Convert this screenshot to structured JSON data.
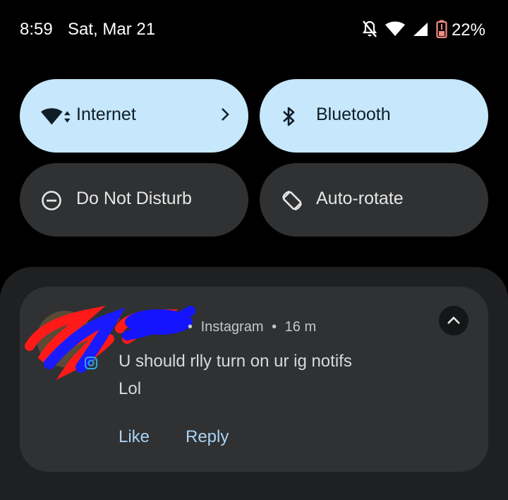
{
  "status_bar": {
    "time": "8:59",
    "date": "Sat, Mar 21",
    "battery_percent": "22%",
    "icons": [
      "bell-off-icon",
      "wifi-icon",
      "cell-signal-icon",
      "battery-low-icon"
    ]
  },
  "quick_settings": {
    "tiles": [
      {
        "label": "Internet",
        "state": "on",
        "icon": "wifi-icon",
        "has_chevron": true
      },
      {
        "label": "Bluetooth",
        "state": "on",
        "icon": "bluetooth-icon"
      },
      {
        "label": "Do Not Disturb",
        "state": "off",
        "icon": "dnd-icon"
      },
      {
        "label": "Auto-rotate",
        "state": "off",
        "icon": "rotate-icon"
      }
    ]
  },
  "notification": {
    "app": "Instagram",
    "separator": "•",
    "time_ago": "16 m",
    "message_line1": "U should rlly turn on ur ig notifs",
    "message_line2": "Lol",
    "actions": [
      "Like",
      "Reply"
    ]
  },
  "colors": {
    "background": "#000000",
    "tile_on": "#c6e7fc",
    "tile_off": "#2f3133",
    "notification_bg": "#2f3133",
    "action_text": "#a9d2f3",
    "battery_low": "#f28b82"
  }
}
